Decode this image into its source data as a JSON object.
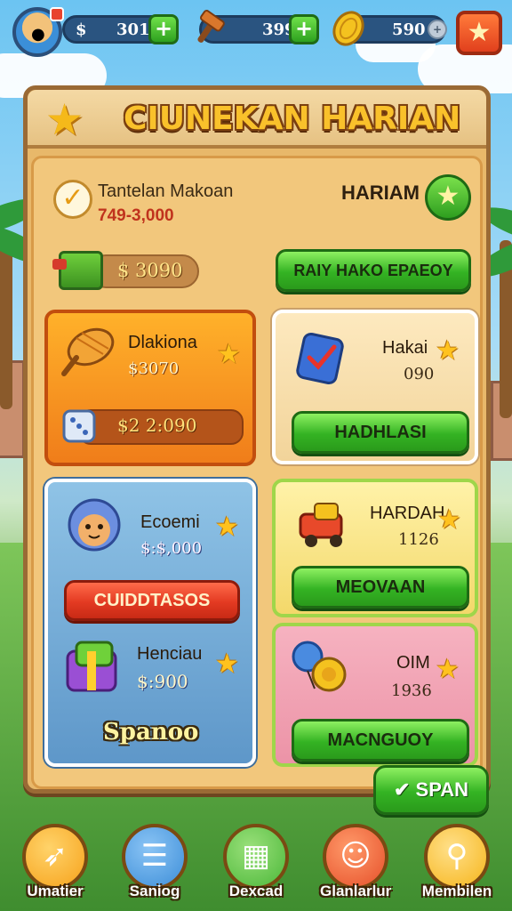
{
  "top_bar": {
    "resources": [
      {
        "prefix": "$",
        "value": "301",
        "icon": "dollar-icon"
      },
      {
        "value": "399",
        "icon": "hammer-icon"
      },
      {
        "value": "590",
        "icon": "gold-coin-icon"
      }
    ],
    "plus_symbol": "+",
    "small_plus_symbol": "+",
    "settings_icon": "star-icon"
  },
  "panel": {
    "title": "CIUNEKAN HARIAN",
    "task": {
      "title": "Tantelan Makoan",
      "subtitle": "749-3,000",
      "harian_label": "HARIAM",
      "reward_value": "$ 3090",
      "button_label": "RAIY HAKO EPAEOY"
    },
    "cards": [
      {
        "title": "Dlakiona",
        "value": "$3070",
        "sub_value": "$2 2:090",
        "icon": "paint-brush-icon",
        "sub_icon": "dice-icon"
      },
      {
        "title": "Hakai",
        "value": "090",
        "button_label": "HADHLASI",
        "icon": "blue-book-icon"
      },
      {
        "title": "Ecoemi",
        "value": "$:$,000",
        "button_label": "CUIDDTASOS",
        "icon": "blue-creature-icon",
        "second_title": "Henciau",
        "second_value": "$:900",
        "second_icon": "gift-box-icon",
        "footer": "Spanoo"
      },
      {
        "title": "HARDAH",
        "value": "1126",
        "button_label": "MEOVAAN",
        "icon": "toy-truck-icon"
      },
      {
        "title": "OIM",
        "value": "1936",
        "button_label": "MACNGUOY",
        "icon": "balloon-toy-icon"
      }
    ],
    "span_button": "SPAN"
  },
  "bottom_nav": [
    {
      "label": "Umatier",
      "icon": "arrow-icon",
      "color": "#f6a21b"
    },
    {
      "label": "Saniog",
      "icon": "list-icon",
      "color": "#3d8ed8"
    },
    {
      "label": "Dexcad",
      "icon": "map-icon",
      "color": "#4cb83a"
    },
    {
      "label": "Glanlarlur",
      "icon": "lion-icon",
      "color": "#e6502a"
    },
    {
      "label": "Membilen",
      "icon": "pin-icon",
      "color": "#f6b51b"
    }
  ]
}
